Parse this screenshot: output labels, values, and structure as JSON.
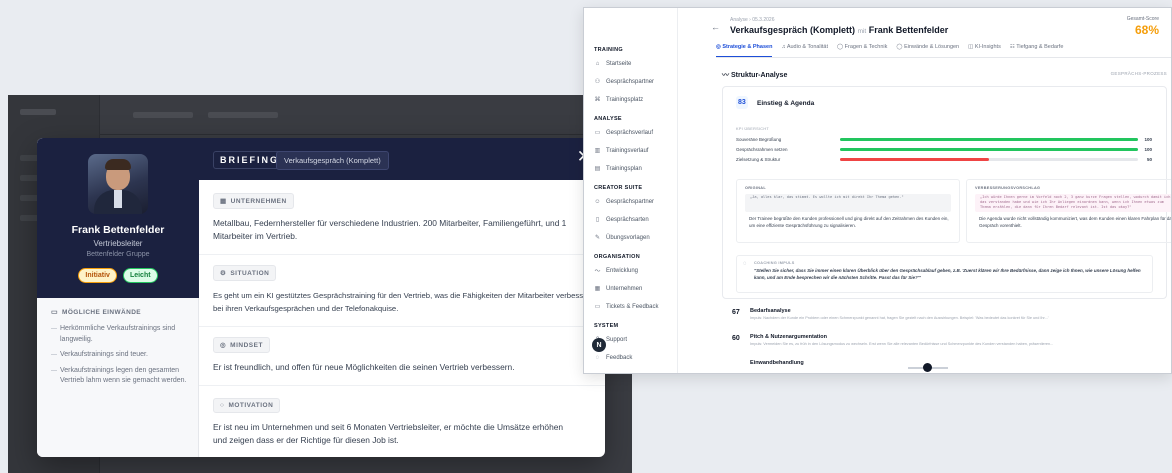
{
  "modal": {
    "profile": {
      "name": "Frank Bettenfelder",
      "role": "Vertriebsleiter",
      "company": "Bettenfelder Gruppe",
      "badges": [
        "Initiativ",
        "Leicht"
      ]
    },
    "objections": {
      "title": "MÖGLICHE EINWÄNDE",
      "items": [
        "Herkömmliche Verkaufstrainings sind langweilig.",
        "Verkaufstrainings sind teuer.",
        "Verkaufstrainings legen den gesamten Vertrieb lahm wenn sie gemacht werden."
      ]
    },
    "header": {
      "briefing": "BRIEFING",
      "tag": "Verkaufsgespräch (Komplett)",
      "close": "✕"
    },
    "sections": {
      "company": {
        "label": "UNTERNEHMEN",
        "line1": "Metallbau, Federnhersteller für verschiedene Industrien. 200 Mitarbeiter, Familiengeführt, und 1",
        "line2": "Mitarbeiter im Vertrieb."
      },
      "situation": {
        "label": "SITUATION",
        "line1": "Es geht um ein KI gestütztes Gesprächstraining für den Vertrieb, was die Fähigkeiten der Mitarbeiter verbessert",
        "line2": "bei ihren Verkaufsgesprächen und der Telefonakquise."
      },
      "mindset": {
        "label": "MINDSET",
        "line1": "Er ist freundlich, und offen für neue Möglichkeiten die seinen Vertrieb verbessern."
      },
      "motivation": {
        "label": "MOTIVATION",
        "line1": "Er ist neu im Unternehmen und seit 6 Monaten Vertriebsleiter, er möchte die Umsätze erhöhen",
        "line2": "und zeigen dass er der Richtige für diesen Job ist."
      }
    }
  },
  "window": {
    "sidebar": {
      "groups": {
        "training": "TRAINING",
        "analyse": "ANALYSE",
        "creator": "CREATOR SUITE",
        "organisation": "ORGANISATION",
        "system": "SYSTEM"
      },
      "items": {
        "startseite": "Startseite",
        "gespraechspartner": "Gesprächspartner",
        "trainingsplatz": "Trainingsplatz",
        "gespraechsverlauf": "Gesprächsverlauf",
        "trainingsverlauf": "Trainingsverlauf",
        "trainingsplan": "Trainingsplan",
        "cs_partner": "Gesprächspartner",
        "gespraechsarten": "Gesprächsarten",
        "uebungsvorlagen": "Übungsvorlagen",
        "entwicklung": "Entwicklung",
        "unternehmen": "Unternehmen",
        "tickets": "Tickets & Feedback",
        "support": "Support",
        "feedback": "Feedback"
      },
      "fab": "N"
    },
    "header": {
      "back": "←",
      "crumb": "Analyse  ›  05.3.2026",
      "title": "Verkaufsgespräch (Komplett)",
      "mit": "mit",
      "partner": "Frank Bettenfelder",
      "score_label": "Gesamt-Score",
      "score": "68%"
    },
    "tabs": [
      "◎ Strategie & Phasen",
      "♫ Audio & Tonalität",
      "◯ Fragen & Technik",
      "◯ Einwände & Lösungen",
      "◫ KI-Insights",
      "☷ Tiefgang & Bedarfe"
    ],
    "section": {
      "title": "〰 Struktur-Analyse",
      "right": "GESPRÄCHS-PROZESS"
    },
    "phase": {
      "number": "83",
      "title": "Einstieg & Agenda",
      "sub": "KPI ÜBERSICHT",
      "bars": [
        {
          "label": "Souveräne Begrüßung",
          "value": 100,
          "color": "#22c55e"
        },
        {
          "label": "Gesprächsrahmen setzen",
          "value": 100,
          "color": "#22c55e"
        },
        {
          "label": "Zielsetzung & Struktur",
          "value": 50,
          "color": "#ef4444"
        }
      ],
      "original": {
        "label": "ORIGINAL",
        "quote": "„Ja, alles klar, das stimmt. Es wollte ich mit direkt Ihr Thema gehen.\"",
        "text": "Der Trainee begrüßte den Kunden professionell und ging direkt auf den Zeitrahmen des Kunden ein, um eine effiziente Gesprächsführung zu signalisieren."
      },
      "improve": {
        "label": "VERBESSERUNGSVORSCHLAG",
        "quote": "„Ich würde Ihnen gerne im Vorfeld noch 2, 3 ganz kurze Fragen stellen, wodurch damit ich das verstanden habe und wie ich Ihr Anliegen einordnen kann, wenn ich Ihnen etwas zum Thema erzählen, die dann für Ihren Bedarf relevant ist. Ist das okay?\"",
        "text": "Die Agenda wurde nicht vollständig kommuniziert, was dem Kunden einen klaren Fahrplan für das Gespräch vorenthielt."
      },
      "coaching": {
        "label": "COACHING IMPULS",
        "text": "\"Stellen Sie sicher, dass Sie immer einen klaren Überblick über den Gesprächsablauf geben, z.B. 'Zuerst klären wir Ihre Bedürfnisse, dann zeige ich Ihnen, wie unsere Lösung helfen kann, und am Ende besprechen wir die nächsten Schritte. Passt das für Sie?'\""
      }
    },
    "rows": [
      {
        "num": "67",
        "title": "Bedarfsanalyse",
        "desc": "Impuls: Nachdem der Kunde ein Problem oder einen Schmerzpunkt genannt hat, fragen Sie gezielt nach den Auswirkungen. Beispiel: 'Was bedeutet das konkret für Sie und Ihr...'"
      },
      {
        "num": "60",
        "title": "Pitch & Nutzenargumentation",
        "desc": "Impuls: Vermeiden Sie es, zu früh in den Lösungsmodus zu wechseln. Erst wenn Sie alle relevanten Bedürfnisse und Schmerzpunkte des Kunden verstanden haben, präsentieren..."
      },
      {
        "num": "",
        "title": "Einwandbehandlung",
        "desc": ""
      }
    ]
  }
}
